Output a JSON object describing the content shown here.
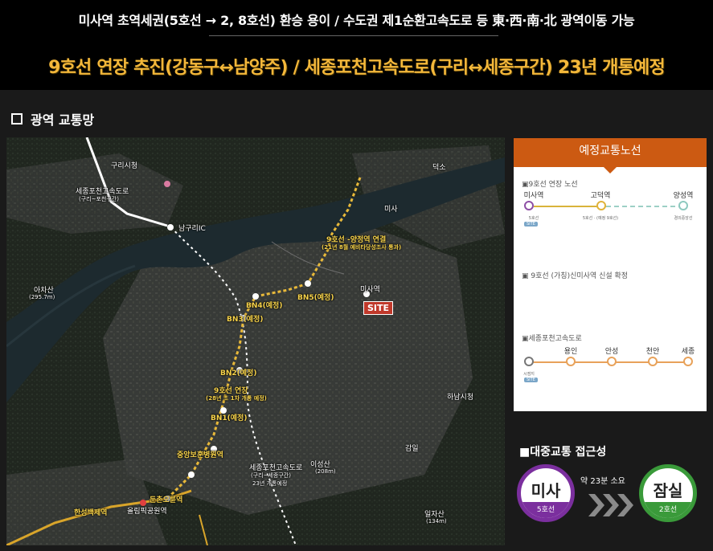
{
  "banner": {
    "line1": "미사역 초역세권(5호선 → 2, 8호선) 환승 용이 / 수도권 제1순환고속도로 등 東·西·南·北 광역이동 가능",
    "line2": "9호선 연장 추진(강동구↔남양주) / 세종포천고속도로(구리↔세종구간) 23년 개통예정"
  },
  "section_title": "광역 교통망",
  "map": {
    "labels": {
      "highway_left": "세종포천고속도로",
      "highway_left_sub": "(구리~포천구간)",
      "namguri_ic": "남구리IC",
      "guri": "구리시청",
      "achasan": "아차산",
      "achasan_sub": "(295.7m)",
      "line9_connect": "9호선 -양정역 연결",
      "line9_connect_sub": "(21년 8월 예비타당성조사 통과)",
      "bn4": "BN4(예정)",
      "bn5": "BN5(예정)",
      "bn3": "BN3(예정)",
      "bn2": "BN2(예정)",
      "bn1": "BN1(예정)",
      "line9_ext": "9호선 연장",
      "line9_ext_sub": "(28년 초 1차 개통 예정)",
      "misa": "미사역",
      "site": "SITE",
      "misa_area": "미사",
      "jungang": "중앙보훈병원역",
      "dunchon": "둔촌오륜역",
      "olympic": "올림픽공원역",
      "highway_right": "세종포천고속도로",
      "highway_right_sub": "(구리~세종구간)",
      "highway_right_sub2": "23년 개통예정",
      "hansung": "한성백제역",
      "ilja": "일자산",
      "ilja_sub": "(134m)",
      "gamil": "감일",
      "icheon": "이성산",
      "icheon_sub": "(208m)",
      "deokso": "덕소",
      "hanam": "하남시청"
    }
  },
  "legend": {
    "header": "예정교통노선",
    "line9": {
      "title": "▣9호선  연장 노선",
      "stations": [
        {
          "name": "미사역",
          "sub": "5호선",
          "chip": "SITE"
        },
        {
          "name": "고덕역",
          "sub": "5호선 · (예정 9호선)",
          "chip": ""
        },
        {
          "name": "양성역",
          "sub": "경의중앙선",
          "chip": ""
        }
      ],
      "colors": {
        "line": "#d9b33a",
        "dashed": "#9dd0c6",
        "start": "#8e4fa6",
        "mid": "#e0b33a",
        "end": "#8ec9bf"
      }
    },
    "line9_new": {
      "title": "▣ 9호선 (가칭)신미사역 신설 확정"
    },
    "sejong": {
      "title": "▣세종포천고속도로",
      "stations": [
        {
          "name": "",
          "sub": "시점지",
          "chip": "SITE"
        },
        {
          "name": "용인",
          "sub": "",
          "chip": ""
        },
        {
          "name": "안성",
          "sub": "",
          "chip": ""
        },
        {
          "name": "천안",
          "sub": "",
          "chip": ""
        },
        {
          "name": "세종",
          "sub": "",
          "chip": ""
        }
      ],
      "colors": {
        "line": "#e8a25a",
        "start": "#777777",
        "node": "#e8a25a"
      }
    }
  },
  "transit": {
    "title": "■대중교통 접근성",
    "from": {
      "name": "미사",
      "line": "5호선",
      "color": "#7b2f9e"
    },
    "to": {
      "name": "잠실",
      "line": "2호선",
      "color": "#3a9a3a"
    },
    "travel": "약 23분 소요"
  }
}
